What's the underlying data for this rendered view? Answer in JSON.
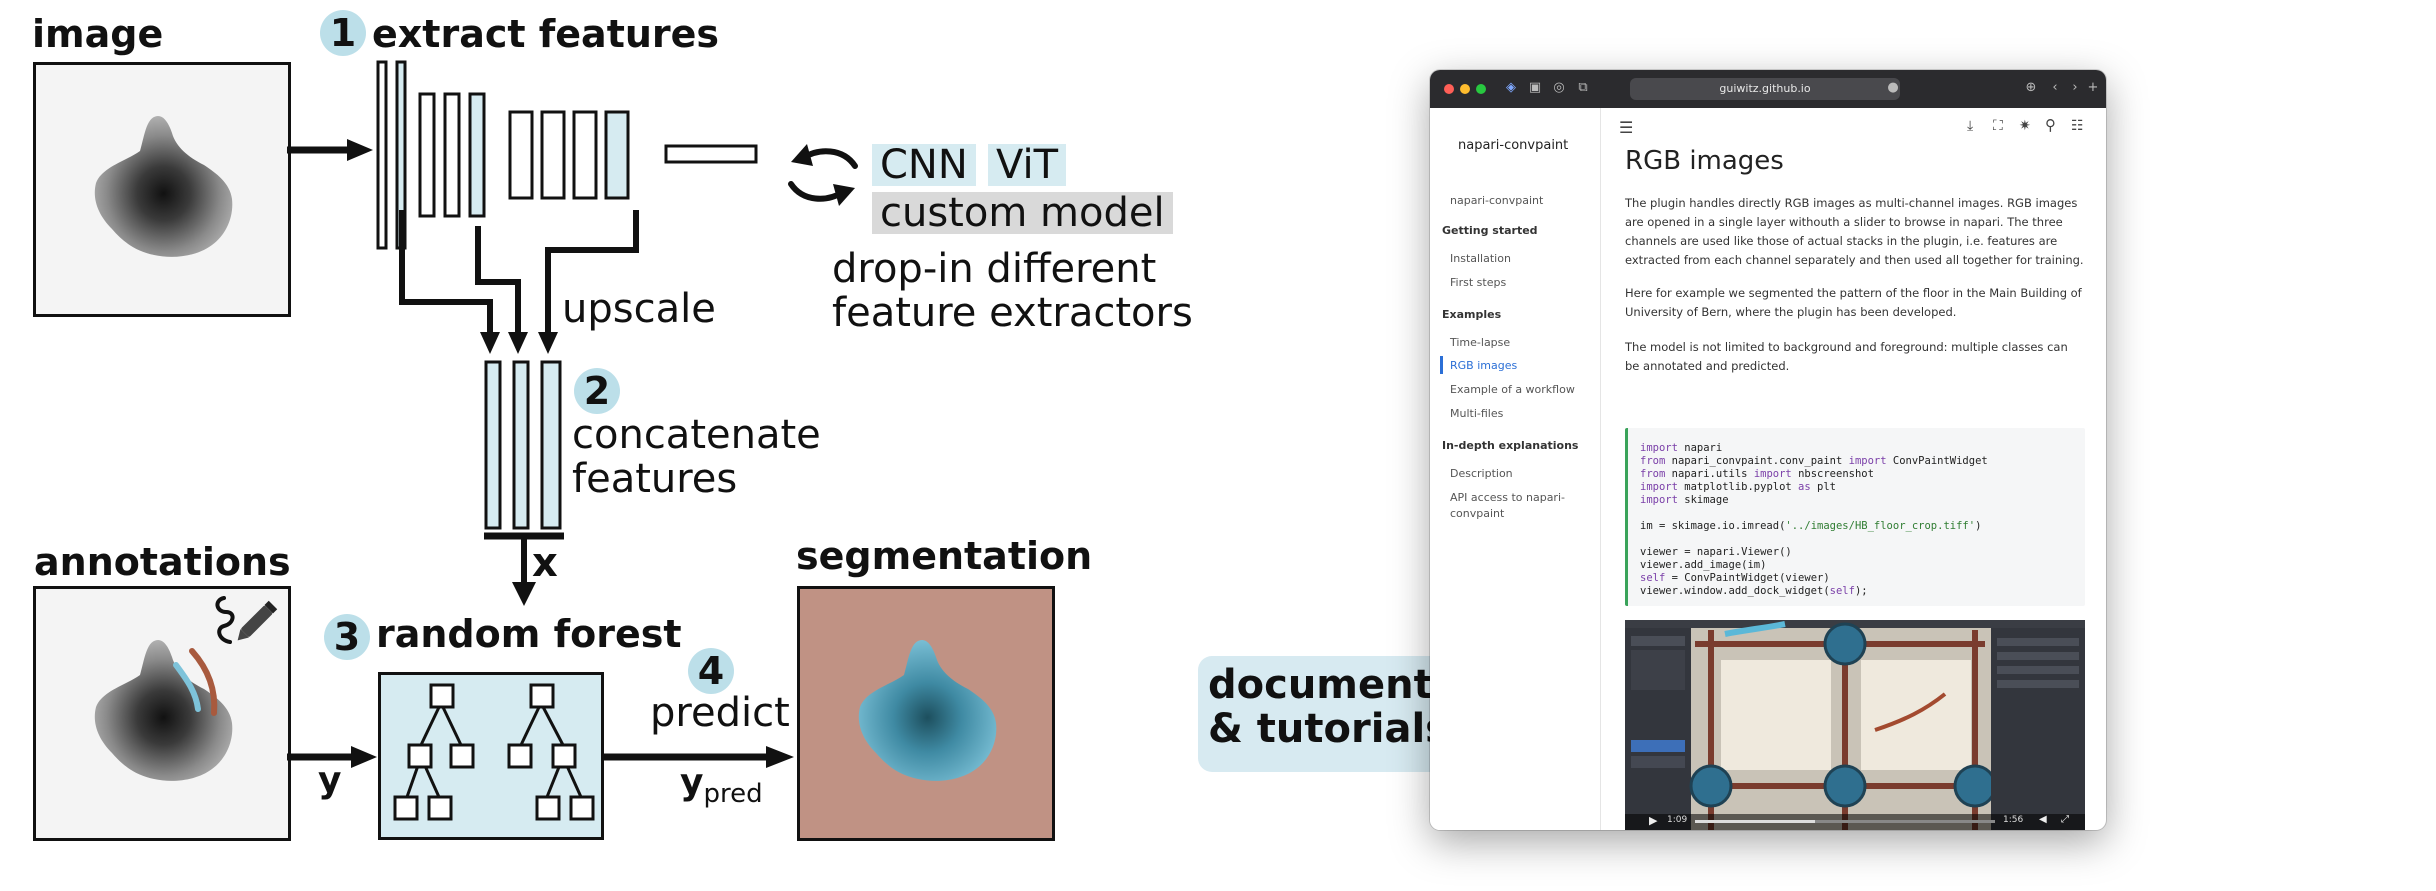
{
  "labels": {
    "image": "image",
    "step1_num": "1",
    "step1": "extract features",
    "upscale": "upscale",
    "step2_num": "2",
    "step2_line1": "concatenate",
    "step2_line2": "features",
    "x": "x",
    "step3_num": "3",
    "step3": "random forest",
    "step4_num": "4",
    "predict": "predict",
    "y": "y",
    "ypred_main": "y",
    "ypred_sub": "pred",
    "annotations": "annotations",
    "segmentation": "segmentation",
    "cnn": "CNN",
    "vit": "ViT",
    "custom_model": "custom model",
    "dropin_line1": "drop-in different",
    "dropin_line2": "feature extractors",
    "doc_line1": "documentation",
    "doc_line2": "& tutorials"
  },
  "colors": {
    "accent_blue": "#bcdfe9",
    "feature_fill": "#d6ebf1",
    "gray_chip": "#d9d9d9",
    "seg_background": "#c09284",
    "seg_object": "#62a9c0",
    "annotation_red": "#a85a3e",
    "annotation_blue": "#7ec3da"
  },
  "browser": {
    "url": "guiwitz.github.io",
    "site_title": "napari-convpaint",
    "sidebar": {
      "home": "napari-convpaint",
      "getting_started": "Getting started",
      "installation": "Installation",
      "first_steps": "First steps",
      "examples": "Examples",
      "time_lapse": "Time-lapse",
      "rgb_images": "RGB images",
      "workflow": "Example of a workflow",
      "multi_files": "Multi-files",
      "in_depth": "In-depth explanations",
      "description": "Description",
      "api_line1": "API access to napari-",
      "api_line2": "convpaint"
    },
    "page_title": "RGB images",
    "para1": "The plugin handles directly RGB images as multi-channel images. RGB images are opened in a single layer withouth a slider to browse in napari. The three channels are used like those of actual stacks in the plugin, i.e. features are extracted from each channel separately and then used all together for training.",
    "para2": "Here for example we segmented the pattern of the floor in the Main Building of University of Bern, where the plugin has been developed.",
    "para3": "The model is not limited to background and foreground: multiple classes can be annotated and predicted.",
    "code": {
      "l1_kw": "import",
      "l1_rest": " napari",
      "l2_kw1": "from",
      "l2_mid": " napari_convpaint.conv_paint ",
      "l2_kw2": "import",
      "l2_rest": " ConvPaintWidget",
      "l3_kw1": "from",
      "l3_mid": " napari.utils ",
      "l3_kw2": "import",
      "l3_rest": " nbscreenshot",
      "l4_kw1": "import",
      "l4_mid": " matplotlib.pyplot ",
      "l4_kw2": "as",
      "l4_rest": " plt",
      "l5_kw": "import",
      "l5_rest": " skimage",
      "l6_pre": "im = skimage.io.imread(",
      "l6_str": "'../images/HB_floor_crop.tiff'",
      "l6_post": ")",
      "l7": "viewer = napari.Viewer()",
      "l8": "viewer.add_image(im)",
      "l9_kw": "self",
      "l9_rest": " = ConvPaintWidget(viewer)",
      "l10_pre": "viewer.window.add_dock_widget(",
      "l10_kw": "self",
      "l10_post": ");"
    },
    "video_time_start": "1:09",
    "video_time_end": "1:56"
  }
}
